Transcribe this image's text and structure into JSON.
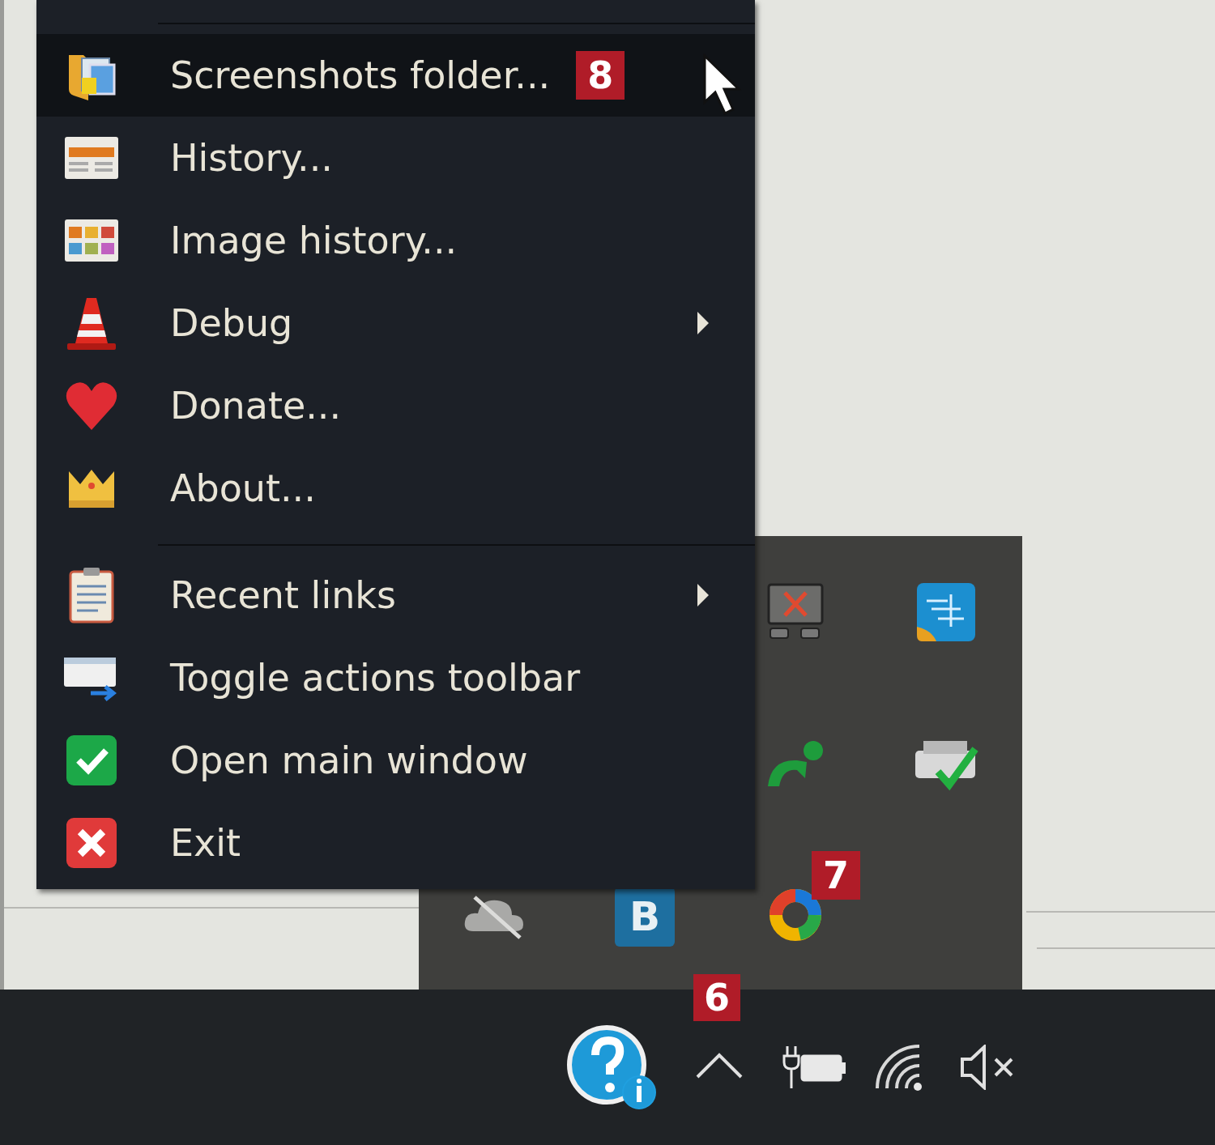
{
  "menu": {
    "items": [
      {
        "kind": "separator"
      },
      {
        "kind": "item",
        "label": "Screenshots folder...",
        "selected": true,
        "submenu": false,
        "badge": "8"
      },
      {
        "kind": "item",
        "label": "History...",
        "selected": false,
        "submenu": false
      },
      {
        "kind": "item",
        "label": "Image history...",
        "selected": false,
        "submenu": false
      },
      {
        "kind": "item",
        "label": "Debug",
        "selected": false,
        "submenu": true
      },
      {
        "kind": "item",
        "label": "Donate...",
        "selected": false,
        "submenu": false
      },
      {
        "kind": "item",
        "label": "About...",
        "selected": false,
        "submenu": false
      },
      {
        "kind": "separator"
      },
      {
        "kind": "item",
        "label": "Recent links",
        "selected": false,
        "submenu": true
      },
      {
        "kind": "item",
        "label": "Toggle actions toolbar",
        "selected": false,
        "submenu": false
      },
      {
        "kind": "item",
        "label": "Open main window",
        "selected": false,
        "submenu": false
      },
      {
        "kind": "item",
        "label": "Exit",
        "selected": false,
        "submenu": false
      }
    ]
  },
  "tray_overflow": {
    "icons": [
      {
        "kind": "icon"
      },
      {
        "kind": "icon"
      },
      {
        "kind": "icon"
      },
      {
        "kind": "icon"
      },
      {
        "kind": "icon"
      },
      {
        "kind": "letter",
        "label": "B"
      },
      {
        "kind": "icon",
        "badge": "7"
      }
    ]
  },
  "taskbar": {
    "badge": "6"
  }
}
